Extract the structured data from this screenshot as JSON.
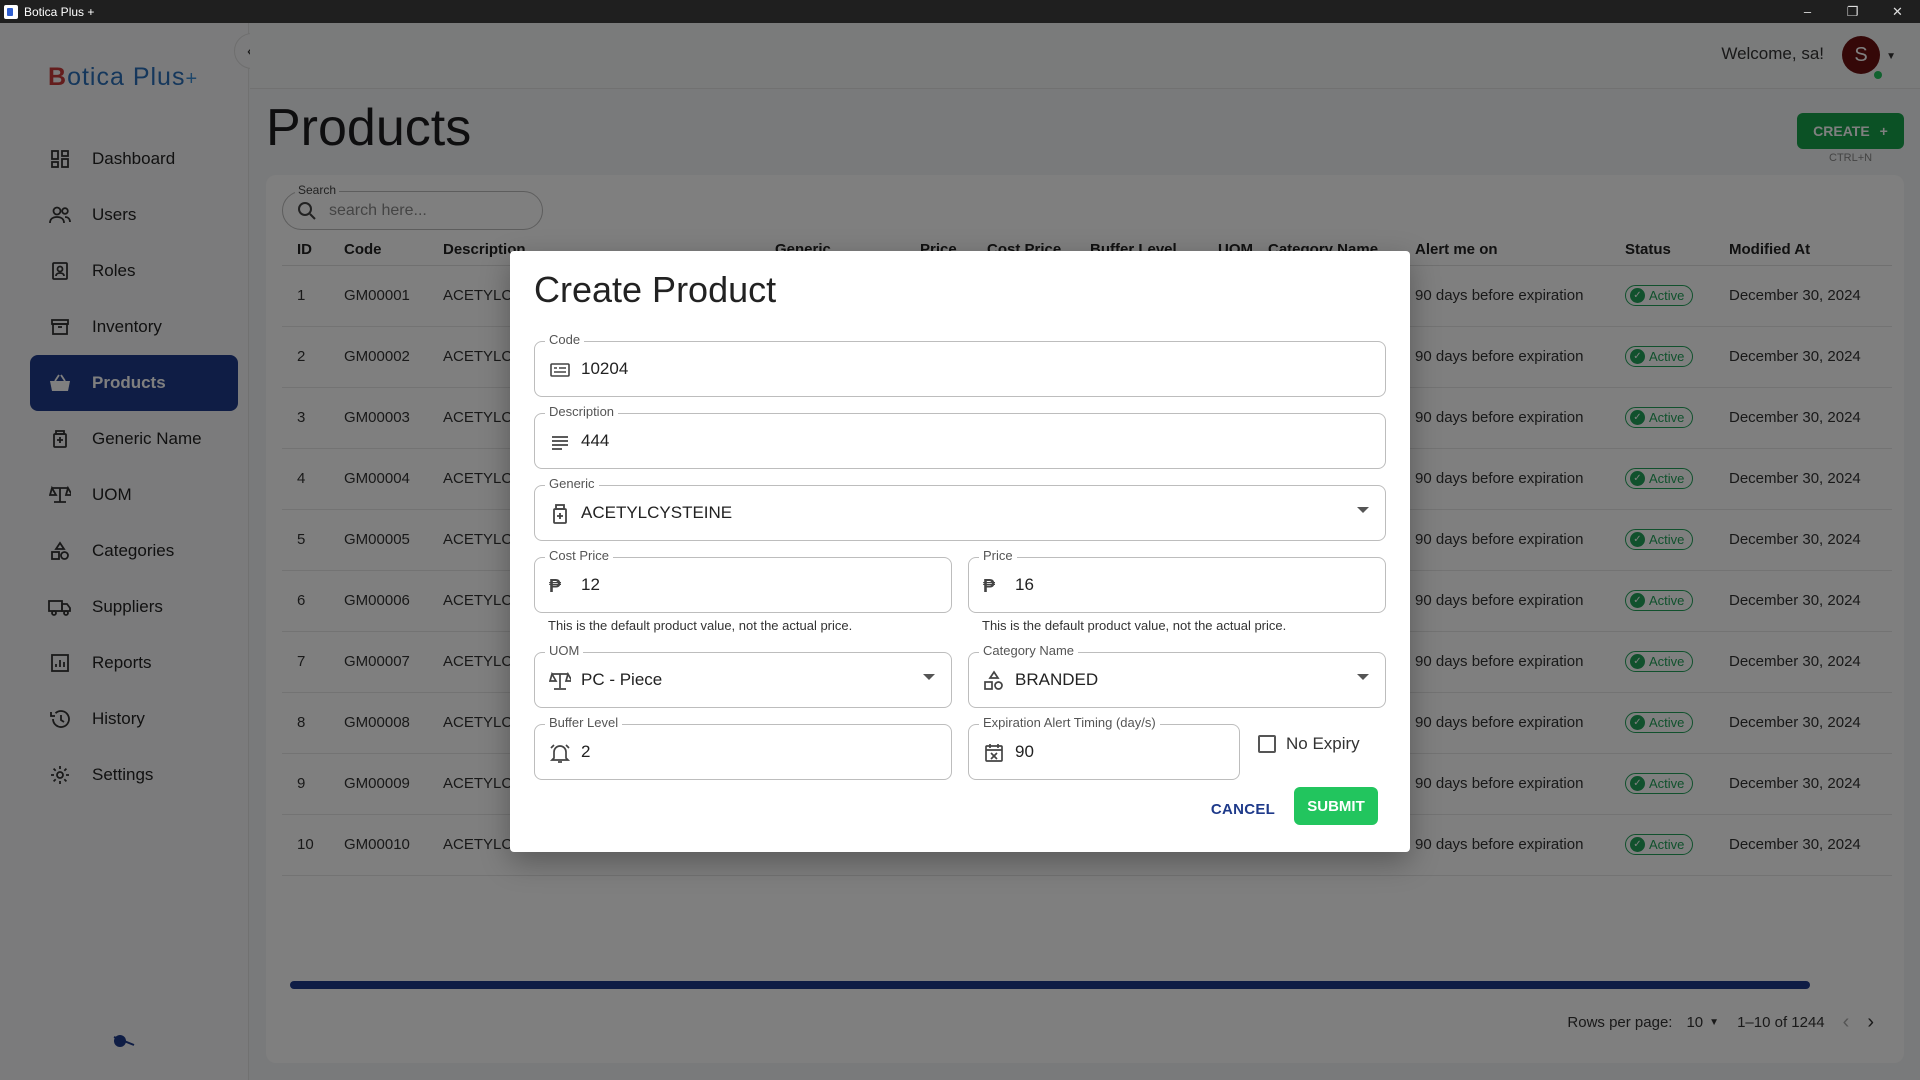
{
  "window": {
    "title": "Botica Plus +",
    "controls": [
      "–",
      "❐",
      "✕"
    ]
  },
  "brand": {
    "b": "B",
    "rest": "otica Plus",
    "plus": "+"
  },
  "sidebar": {
    "items": [
      {
        "label": "Dashboard",
        "icon": "dashboard-icon"
      },
      {
        "label": "Users",
        "icon": "users-icon"
      },
      {
        "label": "Roles",
        "icon": "roles-icon"
      },
      {
        "label": "Inventory",
        "icon": "inventory-icon"
      },
      {
        "label": "Products",
        "icon": "basket-icon",
        "active": true
      },
      {
        "label": "Generic Name",
        "icon": "medicine-icon"
      },
      {
        "label": "UOM",
        "icon": "scale-icon"
      },
      {
        "label": "Categories",
        "icon": "categories-icon"
      },
      {
        "label": "Suppliers",
        "icon": "truck-icon"
      },
      {
        "label": "Reports",
        "icon": "reports-icon"
      },
      {
        "label": "History",
        "icon": "history-icon"
      },
      {
        "label": "Settings",
        "icon": "gear-icon"
      }
    ]
  },
  "header": {
    "welcome": "Welcome, sa!",
    "avatar_letter": "S"
  },
  "page": {
    "title": "Products",
    "create_label": "CREATE",
    "create_hint": "CTRL+N"
  },
  "search": {
    "label": "Search",
    "placeholder": "search here..."
  },
  "table": {
    "columns": [
      "ID",
      "Code",
      "Description",
      "Generic",
      "Price",
      "Cost Price",
      "Buffer Level",
      "UOM",
      "Category Name",
      "Alert me on",
      "Status",
      "Modified At"
    ],
    "rows": [
      {
        "id": "1",
        "code": "GM00001",
        "desc": "ACETYLCY",
        "alert": "90 days before expiration",
        "status": "Active",
        "modified": "December 30, 2024"
      },
      {
        "id": "2",
        "code": "GM00002",
        "desc": "ACETYLCY",
        "alert": "90 days before expiration",
        "status": "Active",
        "modified": "December 30, 2024"
      },
      {
        "id": "3",
        "code": "GM00003",
        "desc": "ACETYLCY",
        "alert": "90 days before expiration",
        "status": "Active",
        "modified": "December 30, 2024"
      },
      {
        "id": "4",
        "code": "GM00004",
        "desc": "ACETYLCY",
        "alert": "90 days before expiration",
        "status": "Active",
        "modified": "December 30, 2024"
      },
      {
        "id": "5",
        "code": "GM00005",
        "desc": "ACETYLCY",
        "alert": "90 days before expiration",
        "status": "Active",
        "modified": "December 30, 2024"
      },
      {
        "id": "6",
        "code": "GM00006",
        "desc": "ACETYLCY",
        "alert": "90 days before expiration",
        "status": "Active",
        "modified": "December 30, 2024"
      },
      {
        "id": "7",
        "code": "GM00007",
        "desc": "ACETYLCY",
        "alert": "90 days before expiration",
        "status": "Active",
        "modified": "December 30, 2024"
      },
      {
        "id": "8",
        "code": "GM00008",
        "desc": "ACETYLCY",
        "alert": "90 days before expiration",
        "status": "Active",
        "modified": "December 30, 2024"
      },
      {
        "id": "9",
        "code": "GM00009",
        "desc": "ACETYLCY",
        "alert": "90 days before expiration",
        "status": "Active",
        "modified": "December 30, 2024"
      },
      {
        "id": "10",
        "code": "GM00010",
        "desc": "ACETYLCY",
        "alert": "90 days before expiration",
        "status": "Active",
        "modified": "December 30, 2024"
      }
    ]
  },
  "pagination": {
    "rows_per_page_label": "Rows per page:",
    "rows_per_page": "10",
    "range": "1–10 of 1244"
  },
  "modal": {
    "title": "Create Product",
    "code": {
      "label": "Code",
      "value": "10204"
    },
    "description": {
      "label": "Description",
      "value": "444"
    },
    "generic": {
      "label": "Generic",
      "value": "ACETYLCYSTEINE"
    },
    "cost_price": {
      "label": "Cost Price",
      "value": "12"
    },
    "price": {
      "label": "Price",
      "value": "16"
    },
    "price_helper": "This is the default product value, not the actual price.",
    "uom": {
      "label": "UOM",
      "value": "PC - Piece"
    },
    "category": {
      "label": "Category Name",
      "value": "BRANDED"
    },
    "buffer": {
      "label": "Buffer Level",
      "value": "2"
    },
    "expiration": {
      "label": "Expiration Alert Timing (day/s)",
      "value": "90"
    },
    "no_expiry": "No Expiry",
    "cancel": "CANCEL",
    "submit": "SUBMIT"
  },
  "colors": {
    "primary": "#1e3a8a",
    "success": "#22c55e",
    "create": "#16a34a"
  }
}
